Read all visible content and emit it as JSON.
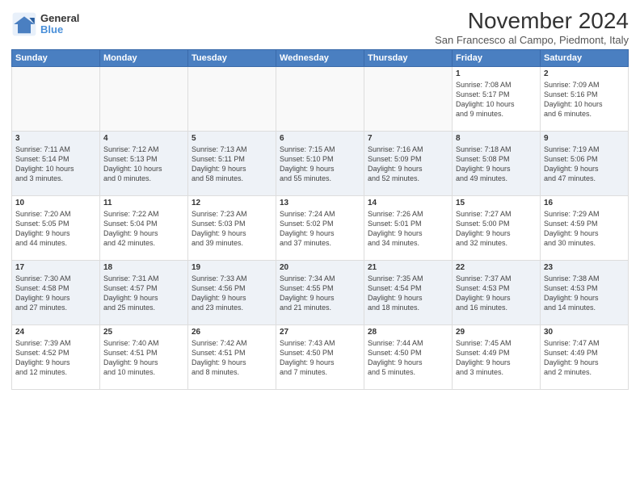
{
  "header": {
    "logo_general": "General",
    "logo_blue": "Blue",
    "title": "November 2024",
    "location": "San Francesco al Campo, Piedmont, Italy"
  },
  "days_of_week": [
    "Sunday",
    "Monday",
    "Tuesday",
    "Wednesday",
    "Thursday",
    "Friday",
    "Saturday"
  ],
  "weeks": [
    [
      {
        "day": "",
        "info": ""
      },
      {
        "day": "",
        "info": ""
      },
      {
        "day": "",
        "info": ""
      },
      {
        "day": "",
        "info": ""
      },
      {
        "day": "",
        "info": ""
      },
      {
        "day": "1",
        "info": "Sunrise: 7:08 AM\nSunset: 5:17 PM\nDaylight: 10 hours\nand 9 minutes."
      },
      {
        "day": "2",
        "info": "Sunrise: 7:09 AM\nSunset: 5:16 PM\nDaylight: 10 hours\nand 6 minutes."
      }
    ],
    [
      {
        "day": "3",
        "info": "Sunrise: 7:11 AM\nSunset: 5:14 PM\nDaylight: 10 hours\nand 3 minutes."
      },
      {
        "day": "4",
        "info": "Sunrise: 7:12 AM\nSunset: 5:13 PM\nDaylight: 10 hours\nand 0 minutes."
      },
      {
        "day": "5",
        "info": "Sunrise: 7:13 AM\nSunset: 5:11 PM\nDaylight: 9 hours\nand 58 minutes."
      },
      {
        "day": "6",
        "info": "Sunrise: 7:15 AM\nSunset: 5:10 PM\nDaylight: 9 hours\nand 55 minutes."
      },
      {
        "day": "7",
        "info": "Sunrise: 7:16 AM\nSunset: 5:09 PM\nDaylight: 9 hours\nand 52 minutes."
      },
      {
        "day": "8",
        "info": "Sunrise: 7:18 AM\nSunset: 5:08 PM\nDaylight: 9 hours\nand 49 minutes."
      },
      {
        "day": "9",
        "info": "Sunrise: 7:19 AM\nSunset: 5:06 PM\nDaylight: 9 hours\nand 47 minutes."
      }
    ],
    [
      {
        "day": "10",
        "info": "Sunrise: 7:20 AM\nSunset: 5:05 PM\nDaylight: 9 hours\nand 44 minutes."
      },
      {
        "day": "11",
        "info": "Sunrise: 7:22 AM\nSunset: 5:04 PM\nDaylight: 9 hours\nand 42 minutes."
      },
      {
        "day": "12",
        "info": "Sunrise: 7:23 AM\nSunset: 5:03 PM\nDaylight: 9 hours\nand 39 minutes."
      },
      {
        "day": "13",
        "info": "Sunrise: 7:24 AM\nSunset: 5:02 PM\nDaylight: 9 hours\nand 37 minutes."
      },
      {
        "day": "14",
        "info": "Sunrise: 7:26 AM\nSunset: 5:01 PM\nDaylight: 9 hours\nand 34 minutes."
      },
      {
        "day": "15",
        "info": "Sunrise: 7:27 AM\nSunset: 5:00 PM\nDaylight: 9 hours\nand 32 minutes."
      },
      {
        "day": "16",
        "info": "Sunrise: 7:29 AM\nSunset: 4:59 PM\nDaylight: 9 hours\nand 30 minutes."
      }
    ],
    [
      {
        "day": "17",
        "info": "Sunrise: 7:30 AM\nSunset: 4:58 PM\nDaylight: 9 hours\nand 27 minutes."
      },
      {
        "day": "18",
        "info": "Sunrise: 7:31 AM\nSunset: 4:57 PM\nDaylight: 9 hours\nand 25 minutes."
      },
      {
        "day": "19",
        "info": "Sunrise: 7:33 AM\nSunset: 4:56 PM\nDaylight: 9 hours\nand 23 minutes."
      },
      {
        "day": "20",
        "info": "Sunrise: 7:34 AM\nSunset: 4:55 PM\nDaylight: 9 hours\nand 21 minutes."
      },
      {
        "day": "21",
        "info": "Sunrise: 7:35 AM\nSunset: 4:54 PM\nDaylight: 9 hours\nand 18 minutes."
      },
      {
        "day": "22",
        "info": "Sunrise: 7:37 AM\nSunset: 4:53 PM\nDaylight: 9 hours\nand 16 minutes."
      },
      {
        "day": "23",
        "info": "Sunrise: 7:38 AM\nSunset: 4:53 PM\nDaylight: 9 hours\nand 14 minutes."
      }
    ],
    [
      {
        "day": "24",
        "info": "Sunrise: 7:39 AM\nSunset: 4:52 PM\nDaylight: 9 hours\nand 12 minutes."
      },
      {
        "day": "25",
        "info": "Sunrise: 7:40 AM\nSunset: 4:51 PM\nDaylight: 9 hours\nand 10 minutes."
      },
      {
        "day": "26",
        "info": "Sunrise: 7:42 AM\nSunset: 4:51 PM\nDaylight: 9 hours\nand 8 minutes."
      },
      {
        "day": "27",
        "info": "Sunrise: 7:43 AM\nSunset: 4:50 PM\nDaylight: 9 hours\nand 7 minutes."
      },
      {
        "day": "28",
        "info": "Sunrise: 7:44 AM\nSunset: 4:50 PM\nDaylight: 9 hours\nand 5 minutes."
      },
      {
        "day": "29",
        "info": "Sunrise: 7:45 AM\nSunset: 4:49 PM\nDaylight: 9 hours\nand 3 minutes."
      },
      {
        "day": "30",
        "info": "Sunrise: 7:47 AM\nSunset: 4:49 PM\nDaylight: 9 hours\nand 2 minutes."
      }
    ]
  ]
}
